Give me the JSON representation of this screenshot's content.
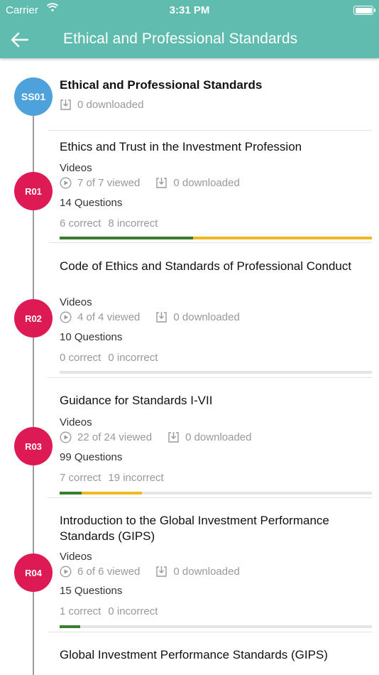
{
  "status_bar": {
    "carrier": "Carrier",
    "time": "3:31 PM"
  },
  "nav": {
    "title": "Ethical and Professional Standards",
    "back_icon": "arrow-left-icon"
  },
  "section": {
    "code": "SS01",
    "title": "Ethical and Professional Standards",
    "downloaded": "0 downloaded"
  },
  "readings": [
    {
      "code": "R01",
      "title": "Ethics and Trust in the Investment Profession",
      "videos_label": "Videos",
      "viewed": "7 of 7 viewed",
      "downloaded": "0 downloaded",
      "questions": "14 Questions",
      "correct": "6 correct",
      "incorrect": "8 incorrect",
      "correct_fraction": 0.4272,
      "incorrect_fraction": 0.5727
    },
    {
      "code": "R02",
      "title": "Code of Ethics and Standards of Professional Conduct",
      "videos_label": "Videos",
      "viewed": "4 of 4 viewed",
      "downloaded": "0 downloaded",
      "questions": "10 Questions",
      "correct": "0 correct",
      "incorrect": "0 incorrect",
      "correct_fraction": 0,
      "incorrect_fraction": 0
    },
    {
      "code": "R03",
      "title": "Guidance for Standards I-VII",
      "videos_label": "Videos",
      "viewed": "22 of 24 viewed",
      "downloaded": "0 downloaded",
      "questions": "99 Questions",
      "correct": "7 correct",
      "incorrect": "19 incorrect",
      "correct_fraction": 0.0707,
      "incorrect_fraction": 0.1919
    },
    {
      "code": "R04",
      "title": "Introduction to the Global Investment Performance Standards (GIPS)",
      "videos_label": "Videos",
      "viewed": "6 of 6 viewed",
      "downloaded": "0 downloaded",
      "questions": "15 Questions",
      "correct": "1 correct",
      "incorrect": "0 incorrect",
      "correct_fraction": 0.0667,
      "incorrect_fraction": 0
    },
    {
      "code": "",
      "title": "Global Investment Performance Standards (GIPS)"
    }
  ],
  "colors": {
    "header": "#5fbcae",
    "section_circle": "#4ea2db",
    "reading_circle": "#de1a55",
    "correct": "#3a7d2f",
    "incorrect": "#efb825",
    "bar_track": "#e5e5e5"
  },
  "icons": {
    "viewed": "play-circle-icon",
    "downloaded": "download-box-icon"
  }
}
